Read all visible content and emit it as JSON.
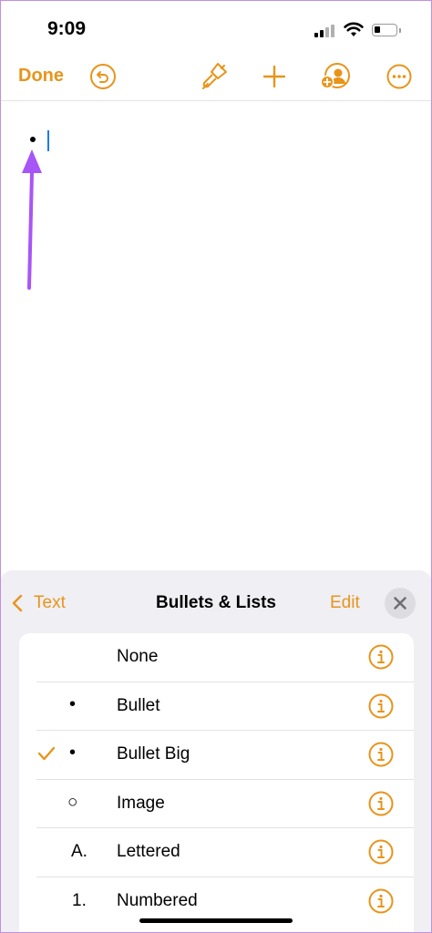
{
  "status_bar": {
    "time": "9:09"
  },
  "toolbar": {
    "done_label": "Done"
  },
  "panel": {
    "back_label": "Text",
    "title": "Bullets & Lists",
    "edit_label": "Edit",
    "items": [
      {
        "label": "None",
        "marker": "",
        "checked": false
      },
      {
        "label": "Bullet",
        "marker": "•",
        "checked": false
      },
      {
        "label": "Bullet Big",
        "marker": "•",
        "checked": true
      },
      {
        "label": "Image",
        "marker": "○",
        "checked": false
      },
      {
        "label": "Lettered",
        "marker": "A.",
        "checked": false
      },
      {
        "label": "Numbered",
        "marker": "1.",
        "checked": false
      }
    ]
  },
  "colors": {
    "accent": "#e8941a",
    "annotation_arrow": "#a855f7",
    "caret": "#1a7cf0"
  }
}
